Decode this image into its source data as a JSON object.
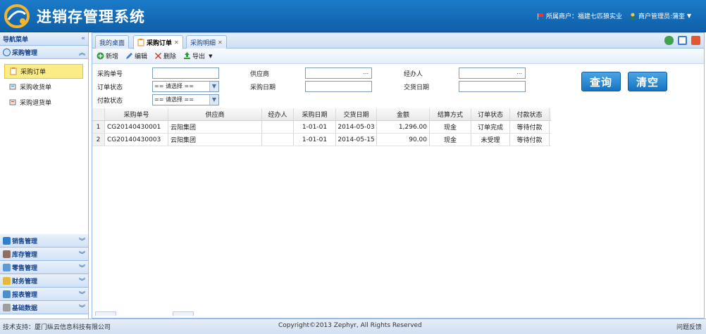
{
  "header": {
    "title": "进销存管理系统",
    "merchant": "所属商户：福建七匹狼实业",
    "admin": "商户管理员:蒲奎"
  },
  "sidebar": {
    "title": "导航菜单",
    "active_group": "采购管理",
    "items": [
      {
        "label": "采购订单",
        "active": true
      },
      {
        "label": "采购收货单",
        "active": false
      },
      {
        "label": "采购退货单",
        "active": false
      }
    ],
    "groups": [
      "销售管理",
      "库存管理",
      "零售管理",
      "财务管理",
      "报表管理",
      "基础数据"
    ]
  },
  "tabs": [
    {
      "label": "我的桌面"
    },
    {
      "label": "采购订单"
    },
    {
      "label": "采购明细"
    }
  ],
  "toolbar": {
    "add": "新增",
    "edit": "编辑",
    "delete": "删除",
    "export": "导出"
  },
  "form": {
    "order_no_label": "采购单号",
    "supplier_label": "供应商",
    "handler_label": "经办人",
    "order_status_label": "订单状态",
    "purchase_date_label": "采购日期",
    "delivery_date_label": "交货日期",
    "payment_status_label": "付款状态",
    "select_placeholder": "== 请选择 ==",
    "lookup": "...",
    "query": "查询",
    "clear": "清空"
  },
  "grid": {
    "headers": [
      "采购单号",
      "供应商",
      "经办人",
      "采购日期",
      "交货日期",
      "金额",
      "结算方式",
      "订单状态",
      "付款状态"
    ],
    "rows": [
      {
        "n": "1",
        "order_no": "CG20140430001",
        "supplier": "云阳集团",
        "handler": "",
        "purchase_date": "1-01-01",
        "delivery_date": "2014-05-03",
        "amount": "1,296.00",
        "settle": "现金",
        "status": "订单完成",
        "pay": "等待付款"
      },
      {
        "n": "2",
        "order_no": "CG20140430003",
        "supplier": "云阳集团",
        "handler": "",
        "purchase_date": "1-01-01",
        "delivery_date": "2014-05-15",
        "amount": "90.00",
        "settle": "现金",
        "status": "未受理",
        "pay": "等待付款"
      }
    ]
  },
  "footer": {
    "support": "技术支持：厦门纵云信息科技有限公司",
    "copyright": "Copyright©2013 Zephyr, All Rights Reserved",
    "feedback": "问题反馈"
  },
  "colors": {
    "header_blue": "#1670bd",
    "query_button": "#2a88d4",
    "active_item": "#fbec88"
  },
  "icons": [
    "logo-icon",
    "flag-icon",
    "user-icon",
    "folder-icon",
    "order-icon",
    "receipt-icon",
    "return-icon",
    "refresh-icon",
    "maximize-icon",
    "close-icon",
    "add-icon",
    "edit-icon",
    "delete-icon",
    "export-icon"
  ]
}
